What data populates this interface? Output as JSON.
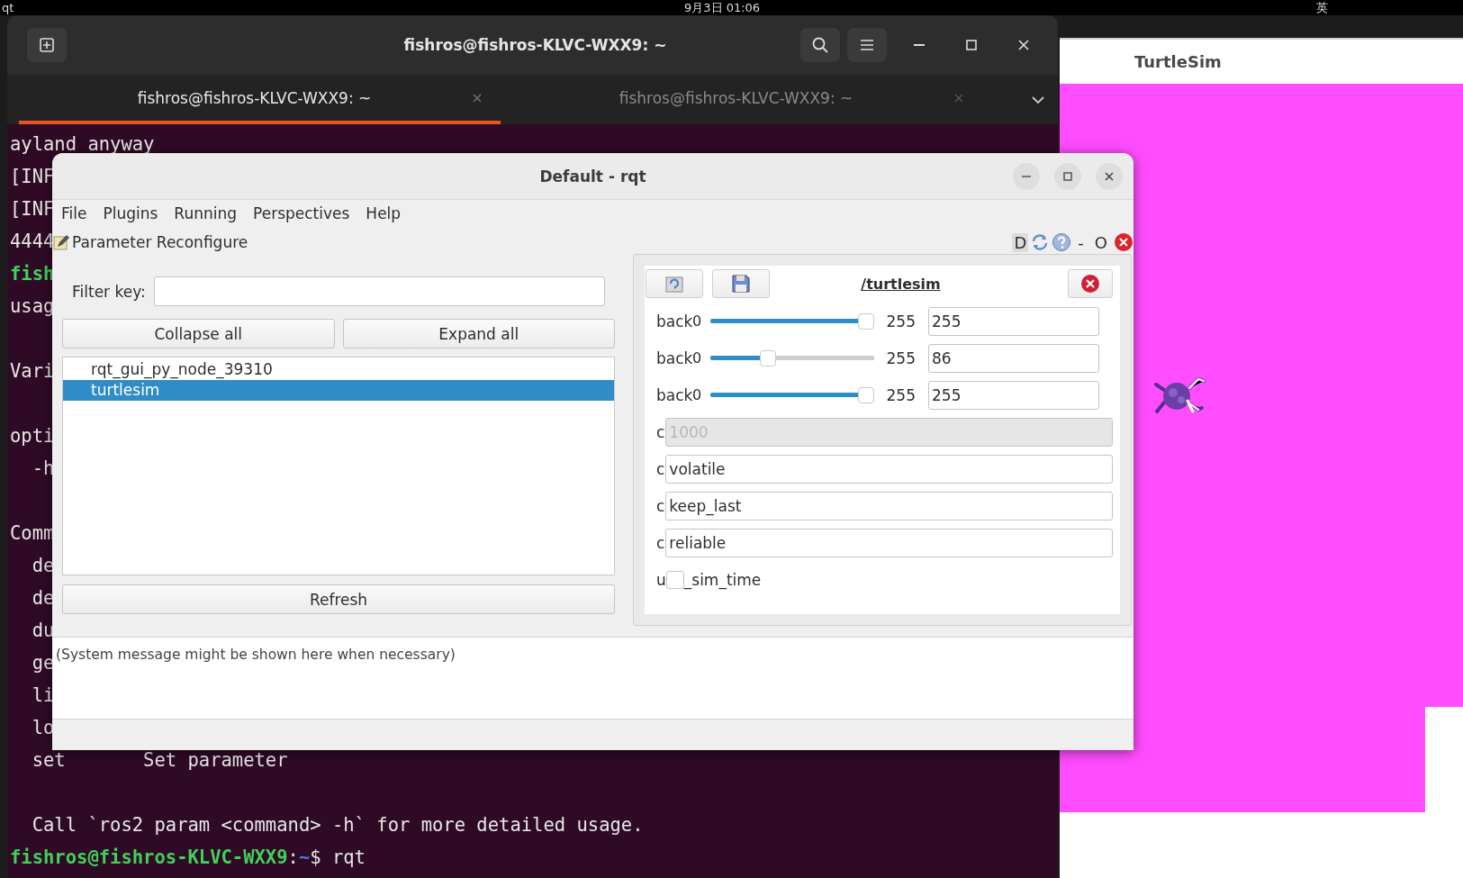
{
  "top_bar": {
    "app": "qt",
    "clock": "9月3日 01:06",
    "input_method": "英"
  },
  "terminal": {
    "title": "fishros@fishros-KLVC-WXX9: ~",
    "tabs": [
      {
        "label": "fishros@fishros-KLVC-WXX9: ~",
        "selected": true
      },
      {
        "label": "fishros@fishros-KLVC-WXX9: ~",
        "selected": false
      }
    ],
    "lines": [
      {
        "kind": "text",
        "segments": [
          {
            "text": "ayland anyway",
            "kind": "plain"
          }
        ]
      },
      {
        "kind": "text",
        "segments": [
          {
            "text": "[INF",
            "kind": "plain"
          }
        ]
      },
      {
        "kind": "text",
        "segments": [
          {
            "text": "[INF",
            "kind": "plain"
          }
        ]
      },
      {
        "kind": "text",
        "segments": [
          {
            "text": "4444",
            "kind": "plain"
          }
        ]
      },
      {
        "kind": "text",
        "segments": [
          {
            "text": "fish",
            "kind": "user"
          }
        ]
      },
      {
        "kind": "text",
        "segments": [
          {
            "text": "usag",
            "kind": "plain"
          }
        ]
      },
      {
        "kind": "blank"
      },
      {
        "kind": "text",
        "segments": [
          {
            "text": "Vari",
            "kind": "plain"
          }
        ]
      },
      {
        "kind": "blank"
      },
      {
        "kind": "text",
        "segments": [
          {
            "text": "opti",
            "kind": "plain"
          }
        ]
      },
      {
        "kind": "text",
        "segments": [
          {
            "text": "  -h",
            "kind": "plain"
          }
        ]
      },
      {
        "kind": "blank"
      },
      {
        "kind": "text",
        "segments": [
          {
            "text": "Comm",
            "kind": "plain"
          }
        ]
      },
      {
        "kind": "text",
        "segments": [
          {
            "text": "  de",
            "kind": "plain"
          }
        ]
      },
      {
        "kind": "text",
        "segments": [
          {
            "text": "  de",
            "kind": "plain"
          }
        ]
      },
      {
        "kind": "text",
        "segments": [
          {
            "text": "  du",
            "kind": "plain"
          }
        ]
      },
      {
        "kind": "text",
        "segments": [
          {
            "text": "  ge",
            "kind": "plain"
          }
        ]
      },
      {
        "kind": "text",
        "segments": [
          {
            "text": "  li",
            "kind": "plain"
          }
        ]
      },
      {
        "kind": "text",
        "segments": [
          {
            "text": "  lo",
            "kind": "plain"
          }
        ]
      },
      {
        "kind": "text",
        "segments": [
          {
            "text": "  set       Set parameter",
            "kind": "plain"
          }
        ]
      },
      {
        "kind": "blank"
      },
      {
        "kind": "text",
        "segments": [
          {
            "text": "  Call `ros2 param <command> -h` for more detailed usage.",
            "kind": "plain"
          }
        ]
      },
      {
        "kind": "text",
        "segments": [
          {
            "text": "fishros@fishros-KLVC-WXX9",
            "kind": "user"
          },
          {
            "text": ":",
            "kind": "plain"
          },
          {
            "text": "~",
            "kind": "path"
          },
          {
            "text": "$ rqt",
            "kind": "plain"
          }
        ]
      }
    ]
  },
  "turtlesim": {
    "title": "TurtleSim"
  },
  "rqt": {
    "title": "Default - rqt",
    "menu": [
      "File",
      "Plugins",
      "Running",
      "Perspectives",
      "Help"
    ],
    "plugin": {
      "title": "Parameter Reconfigure",
      "dock_label": "D",
      "title_buttons": [
        "-",
        "O"
      ]
    },
    "filter": {
      "label": "Filter key:"
    },
    "buttons": [
      "Collapse all",
      "Expand all"
    ],
    "nodes": [
      {
        "label": "rqt_gui_py_node_39310",
        "selected": false
      },
      {
        "label": "turtlesim",
        "selected": true
      }
    ],
    "refresh": "Refresh",
    "node_panel": {
      "title": "/turtlesim",
      "params": [
        {
          "kind": "slider",
          "label": "back",
          "min": "0",
          "max": "255",
          "level": 1,
          "value": "255"
        },
        {
          "kind": "slider",
          "label": "back",
          "min": "0",
          "max": "255",
          "level": 0.337,
          "value": "86"
        },
        {
          "kind": "slider",
          "label": "back",
          "min": "0",
          "max": "255",
          "level": 1,
          "value": "255"
        },
        {
          "kind": "text",
          "label": "c",
          "value": "1000",
          "disabled": true
        },
        {
          "kind": "text",
          "label": "c",
          "value": "volatile",
          "disabled": false
        },
        {
          "kind": "text",
          "label": "c",
          "value": "keep_last",
          "disabled": false
        },
        {
          "kind": "text",
          "label": "c",
          "value": "reliable",
          "disabled": false
        },
        {
          "kind": "checkbox",
          "label": "u",
          "label_after": "_sim_time",
          "checked": false
        }
      ]
    },
    "status": "(System message might be shown here when necessary)"
  }
}
